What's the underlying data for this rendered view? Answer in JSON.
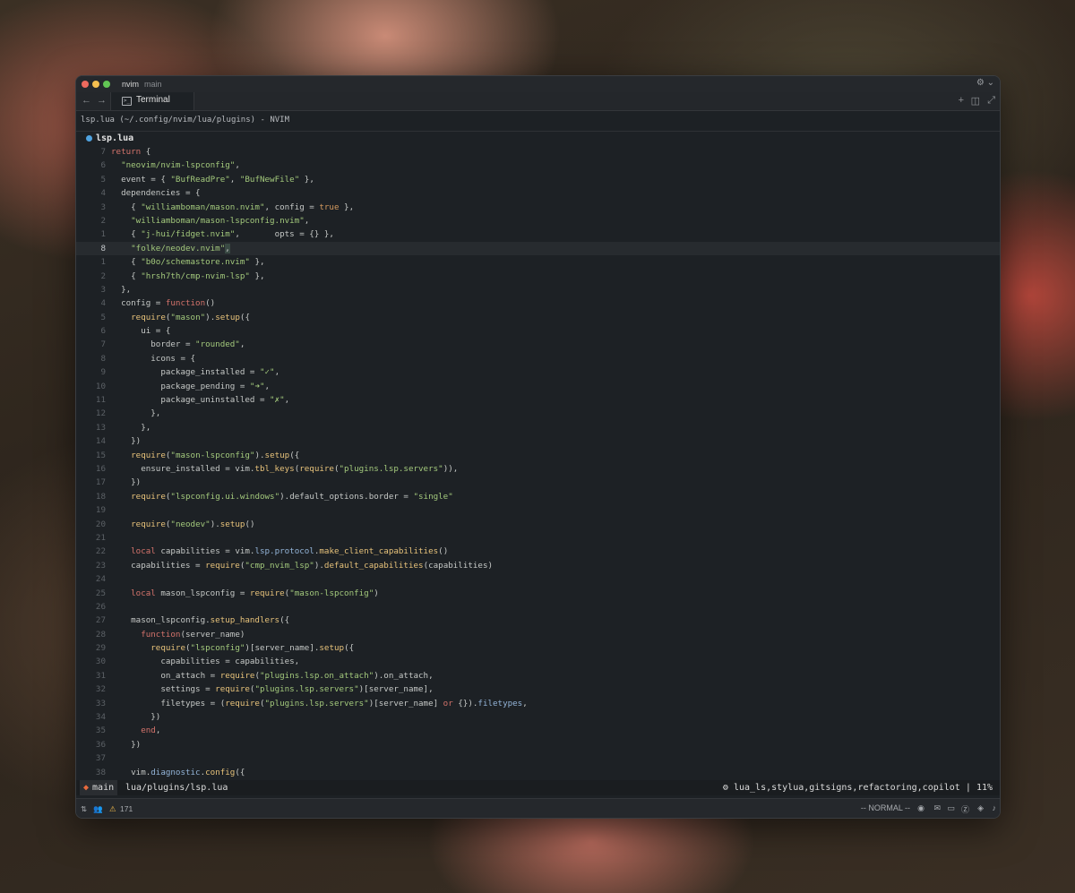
{
  "window": {
    "app_name": "nvim",
    "branch": "main",
    "tab_label": "Terminal",
    "path_title": "lsp.lua (~/.config/nvim/lua/plugins) - NVIMm",
    "buffer_name": "lsp.lua"
  },
  "code_lines": [
    {
      "n": "7",
      "t": [
        [
          "k",
          "return"
        ],
        [
          "d",
          " {"
        ]
      ]
    },
    {
      "n": "6",
      "t": [
        [
          "d",
          "  "
        ],
        [
          "s",
          "\"neovim/nvim-lspconfig\""
        ],
        [
          "d",
          ","
        ]
      ]
    },
    {
      "n": "5",
      "t": [
        [
          "d",
          "  event = { "
        ],
        [
          "s",
          "\"BufReadPre\""
        ],
        [
          "d",
          ", "
        ],
        [
          "s",
          "\"BufNewFile\""
        ],
        [
          "d",
          " },"
        ]
      ]
    },
    {
      "n": "4",
      "t": [
        [
          "d",
          "  dependencies = {"
        ]
      ]
    },
    {
      "n": "3",
      "t": [
        [
          "d",
          "    { "
        ],
        [
          "s",
          "\"williamboman/mason.nvim\""
        ],
        [
          "d",
          ", config = "
        ],
        [
          "b",
          "true"
        ],
        [
          "d",
          " },"
        ]
      ]
    },
    {
      "n": "2",
      "t": [
        [
          "d",
          "    "
        ],
        [
          "s",
          "\"williamboman/mason-lspconfig.nvim\""
        ],
        [
          "d",
          ","
        ]
      ]
    },
    {
      "n": "1",
      "t": [
        [
          "d",
          "    { "
        ],
        [
          "s",
          "\"j-hui/fidget.nvim\""
        ],
        [
          "d",
          ",       opts = {} },"
        ]
      ]
    },
    {
      "n": "8",
      "cur": true,
      "t": [
        [
          "d",
          "    "
        ],
        [
          "s",
          "\"folke/neodev.nvim\""
        ],
        [
          "h",
          ","
        ]
      ]
    },
    {
      "n": "1",
      "t": [
        [
          "d",
          "    { "
        ],
        [
          "s",
          "\"b0o/schemastore.nvim\""
        ],
        [
          "d",
          " },"
        ]
      ]
    },
    {
      "n": "2",
      "t": [
        [
          "d",
          "    { "
        ],
        [
          "s",
          "\"hrsh7th/cmp-nvim-lsp\""
        ],
        [
          "d",
          " },"
        ]
      ]
    },
    {
      "n": "3",
      "t": [
        [
          "d",
          "  },"
        ]
      ]
    },
    {
      "n": "4",
      "t": [
        [
          "d",
          "  config = "
        ],
        [
          "k",
          "function"
        ],
        [
          "d",
          "()"
        ]
      ]
    },
    {
      "n": "5",
      "t": [
        [
          "d",
          "    "
        ],
        [
          "f",
          "require"
        ],
        [
          "d",
          "("
        ],
        [
          "s",
          "\"mason\""
        ],
        [
          "d",
          ")."
        ],
        [
          "f",
          "setup"
        ],
        [
          "d",
          "({"
        ]
      ]
    },
    {
      "n": "6",
      "t": [
        [
          "d",
          "      ui = {"
        ]
      ]
    },
    {
      "n": "7",
      "t": [
        [
          "d",
          "        border = "
        ],
        [
          "s",
          "\"rounded\""
        ],
        [
          "d",
          ","
        ]
      ]
    },
    {
      "n": "8",
      "t": [
        [
          "d",
          "        icons = {"
        ]
      ]
    },
    {
      "n": "9",
      "t": [
        [
          "d",
          "          package_installed = "
        ],
        [
          "s",
          "\"✓\""
        ],
        [
          "d",
          ","
        ]
      ]
    },
    {
      "n": "10",
      "t": [
        [
          "d",
          "          package_pending = "
        ],
        [
          "s",
          "\"➜\""
        ],
        [
          "d",
          ","
        ]
      ]
    },
    {
      "n": "11",
      "t": [
        [
          "d",
          "          package_uninstalled = "
        ],
        [
          "s",
          "\"✗\""
        ],
        [
          "d",
          ","
        ]
      ]
    },
    {
      "n": "12",
      "t": [
        [
          "d",
          "        },"
        ]
      ]
    },
    {
      "n": "13",
      "t": [
        [
          "d",
          "      },"
        ]
      ]
    },
    {
      "n": "14",
      "t": [
        [
          "d",
          "    })"
        ]
      ]
    },
    {
      "n": "15",
      "t": [
        [
          "d",
          "    "
        ],
        [
          "f",
          "require"
        ],
        [
          "d",
          "("
        ],
        [
          "s",
          "\"mason-lspconfig\""
        ],
        [
          "d",
          ")."
        ],
        [
          "f",
          "setup"
        ],
        [
          "d",
          "({"
        ]
      ]
    },
    {
      "n": "16",
      "t": [
        [
          "d",
          "      ensure_installed = vim."
        ],
        [
          "f",
          "tbl_keys"
        ],
        [
          "d",
          "("
        ],
        [
          "f",
          "require"
        ],
        [
          "d",
          "("
        ],
        [
          "s",
          "\"plugins.lsp.servers\""
        ],
        [
          "d",
          ")),"
        ]
      ]
    },
    {
      "n": "17",
      "t": [
        [
          "d",
          "    })"
        ]
      ]
    },
    {
      "n": "18",
      "t": [
        [
          "d",
          "    "
        ],
        [
          "f",
          "require"
        ],
        [
          "d",
          "("
        ],
        [
          "s",
          "\"lspconfig.ui.windows\""
        ],
        [
          "d",
          ").default_options.border = "
        ],
        [
          "s",
          "\"single\""
        ]
      ]
    },
    {
      "n": "19",
      "t": [
        [
          "d",
          ""
        ]
      ]
    },
    {
      "n": "20",
      "t": [
        [
          "d",
          "    "
        ],
        [
          "f",
          "require"
        ],
        [
          "d",
          "("
        ],
        [
          "s",
          "\"neodev\""
        ],
        [
          "d",
          ")."
        ],
        [
          "f",
          "setup"
        ],
        [
          "d",
          "()"
        ]
      ]
    },
    {
      "n": "21",
      "t": [
        [
          "d",
          ""
        ]
      ]
    },
    {
      "n": "22",
      "t": [
        [
          "d",
          "    "
        ],
        [
          "k",
          "local"
        ],
        [
          "d",
          " capabilities = vim."
        ],
        [
          "p",
          "lsp.protocol"
        ],
        [
          "d",
          "."
        ],
        [
          "f",
          "make_client_capabilities"
        ],
        [
          "d",
          "()"
        ]
      ]
    },
    {
      "n": "23",
      "t": [
        [
          "d",
          "    capabilities = "
        ],
        [
          "f",
          "require"
        ],
        [
          "d",
          "("
        ],
        [
          "s",
          "\"cmp_nvim_lsp\""
        ],
        [
          "d",
          ")."
        ],
        [
          "f",
          "default_capabilities"
        ],
        [
          "d",
          "(capabilities)"
        ]
      ]
    },
    {
      "n": "24",
      "t": [
        [
          "d",
          ""
        ]
      ]
    },
    {
      "n": "25",
      "t": [
        [
          "d",
          "    "
        ],
        [
          "k",
          "local"
        ],
        [
          "d",
          " mason_lspconfig = "
        ],
        [
          "f",
          "require"
        ],
        [
          "d",
          "("
        ],
        [
          "s",
          "\"mason-lspconfig\""
        ],
        [
          "d",
          ")"
        ]
      ]
    },
    {
      "n": "26",
      "t": [
        [
          "d",
          ""
        ]
      ]
    },
    {
      "n": "27",
      "t": [
        [
          "d",
          "    mason_lspconfig."
        ],
        [
          "f",
          "setup_handlers"
        ],
        [
          "d",
          "({"
        ]
      ]
    },
    {
      "n": "28",
      "t": [
        [
          "d",
          "      "
        ],
        [
          "k",
          "function"
        ],
        [
          "d",
          "(server_name)"
        ]
      ]
    },
    {
      "n": "29",
      "t": [
        [
          "d",
          "        "
        ],
        [
          "f",
          "require"
        ],
        [
          "d",
          "("
        ],
        [
          "s",
          "\"lspconfig\""
        ],
        [
          "d",
          ")[server_name]."
        ],
        [
          "f",
          "setup"
        ],
        [
          "d",
          "({"
        ]
      ]
    },
    {
      "n": "30",
      "t": [
        [
          "d",
          "          capabilities = capabilities,"
        ]
      ]
    },
    {
      "n": "31",
      "t": [
        [
          "d",
          "          on_attach = "
        ],
        [
          "f",
          "require"
        ],
        [
          "d",
          "("
        ],
        [
          "s",
          "\"plugins.lsp.on_attach\""
        ],
        [
          "d",
          ").on_attach,"
        ]
      ]
    },
    {
      "n": "32",
      "t": [
        [
          "d",
          "          settings = "
        ],
        [
          "f",
          "require"
        ],
        [
          "d",
          "("
        ],
        [
          "s",
          "\"plugins.lsp.servers\""
        ],
        [
          "d",
          ")[server_name],"
        ]
      ]
    },
    {
      "n": "33",
      "t": [
        [
          "d",
          "          filetypes = ("
        ],
        [
          "f",
          "require"
        ],
        [
          "d",
          "("
        ],
        [
          "s",
          "\"plugins.lsp.servers\""
        ],
        [
          "d",
          ")[server_name] "
        ],
        [
          "k",
          "or"
        ],
        [
          "d",
          " {})."
        ],
        [
          "p",
          "filetypes"
        ],
        [
          "d",
          ","
        ]
      ]
    },
    {
      "n": "34",
      "t": [
        [
          "d",
          "        })"
        ]
      ]
    },
    {
      "n": "35",
      "t": [
        [
          "d",
          "      "
        ],
        [
          "k",
          "end"
        ],
        [
          "d",
          ","
        ]
      ]
    },
    {
      "n": "36",
      "t": [
        [
          "d",
          "    })"
        ]
      ]
    },
    {
      "n": "37",
      "t": [
        [
          "d",
          ""
        ]
      ]
    },
    {
      "n": "38",
      "t": [
        [
          "d",
          "    vim."
        ],
        [
          "p",
          "diagnostic"
        ],
        [
          "d",
          "."
        ],
        [
          "f",
          "config"
        ],
        [
          "d",
          "({"
        ]
      ]
    }
  ],
  "statusline": {
    "branch": "main",
    "file": "lua/plugins/lsp.lua",
    "lsp_clients": "lua_ls,stylua,gitsigns,refactoring,copilot",
    "separator": "|",
    "percent": "11%"
  },
  "bottombar": {
    "warnings": "171",
    "mode": "-- NORMAL --"
  },
  "colors": {
    "keyword": "#d4736b",
    "string": "#a3c97c",
    "function": "#e7c27a",
    "property": "#93b4d8",
    "boolean": "#d49a5e"
  }
}
